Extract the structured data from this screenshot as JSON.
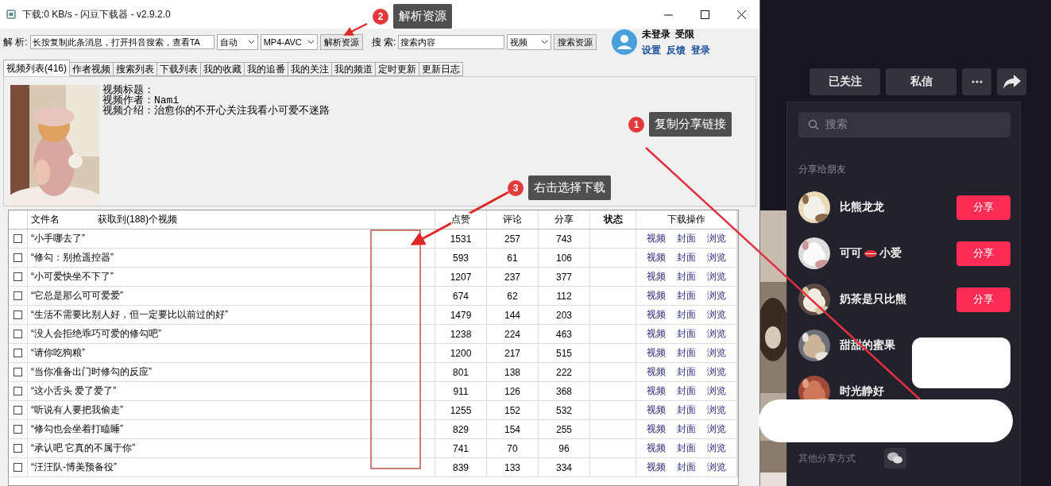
{
  "window": {
    "title": "下载:0 KB/s - 闪豆下载器 - v2.9.2.0"
  },
  "toolbar": {
    "parse_label": "解 析:",
    "parse_value": "长按复制此条消息，打开抖音搜索，查看TA",
    "quality": "自动",
    "codec": "MP4-AVC",
    "parse_button": "解析资源",
    "search_label": "搜 索:",
    "search_value": "搜索内容",
    "search_type": "视频",
    "search_button": "搜索资源"
  },
  "account": {
    "status": "未登录",
    "limit": "受限",
    "links": [
      "设置",
      "反馈",
      "登录"
    ]
  },
  "tabs": [
    {
      "label": "视频列表(416)",
      "selected": true
    },
    {
      "label": "作者视频",
      "selected": false
    },
    {
      "label": "搜索列表",
      "selected": false
    },
    {
      "label": "下载列表",
      "selected": false
    },
    {
      "label": "我的收藏",
      "selected": false
    },
    {
      "label": "我的追番",
      "selected": false
    },
    {
      "label": "我的关注",
      "selected": false
    },
    {
      "label": "我的频道",
      "selected": false
    },
    {
      "label": "定时更新",
      "selected": false
    },
    {
      "label": "更新日志",
      "selected": false
    }
  ],
  "video_info": {
    "kind": "picture",
    "lines": [
      "视频标题：",
      "视频作者：Nami",
      "视频介绍：治愈你的不开心关注我看小可爱不迷路"
    ]
  },
  "table": {
    "columns": [
      "文件名",
      "获取到(188)个视频",
      "点赞",
      "评论",
      "分享",
      "状态",
      "下载操作"
    ],
    "rows": [
      {
        "checked": false,
        "name": "“小手哪去了”",
        "likes": "1531",
        "comments": "257",
        "shares": "743",
        "actions": [
          "视频",
          "封面",
          "浏览"
        ]
      },
      {
        "checked": false,
        "name": "“修勾：别抢遥控器”",
        "likes": "593",
        "comments": "61",
        "shares": "106",
        "actions": [
          "视频",
          "封面",
          "浏览"
        ]
      },
      {
        "checked": false,
        "name": "“小可爱快坐不下了”",
        "likes": "1207",
        "comments": "237",
        "shares": "377",
        "actions": [
          "视频",
          "封面",
          "浏览"
        ]
      },
      {
        "checked": false,
        "name": "“它总是那么可可爱爱”",
        "likes": "674",
        "comments": "62",
        "shares": "112",
        "actions": [
          "视频",
          "封面",
          "浏览"
        ]
      },
      {
        "checked": false,
        "name": "“生活不需要比别人好，但一定要比以前过的好”",
        "likes": "1479",
        "comments": "144",
        "shares": "203",
        "actions": [
          "视频",
          "封面",
          "浏览"
        ]
      },
      {
        "checked": false,
        "name": "“没人会拒绝乖巧可爱的修勾吧”",
        "likes": "1238",
        "comments": "224",
        "shares": "463",
        "actions": [
          "视频",
          "封面",
          "浏览"
        ]
      },
      {
        "checked": false,
        "name": "“请你吃狗粮”",
        "likes": "1200",
        "comments": "217",
        "shares": "515",
        "actions": [
          "视频",
          "封面",
          "浏览"
        ]
      },
      {
        "checked": false,
        "name": "“当你准备出门时修勾的反应”",
        "likes": "801",
        "comments": "138",
        "shares": "222",
        "actions": [
          "视频",
          "封面",
          "浏览"
        ]
      },
      {
        "checked": false,
        "name": "“这小舌头  爱了爱了”",
        "likes": "911",
        "comments": "126",
        "shares": "368",
        "actions": [
          "视频",
          "封面",
          "浏览"
        ]
      },
      {
        "checked": false,
        "name": "“听说有人要把我偷走”",
        "likes": "1255",
        "comments": "152",
        "shares": "532",
        "actions": [
          "视频",
          "封面",
          "浏览"
        ]
      },
      {
        "checked": false,
        "name": "“修勾也会坐着打瞌睡”",
        "likes": "829",
        "comments": "154",
        "shares": "255",
        "actions": [
          "视频",
          "封面",
          "浏览"
        ]
      },
      {
        "checked": false,
        "name": "“承认吧 它真的不属于你”",
        "likes": "741",
        "comments": "70",
        "shares": "96",
        "actions": [
          "视频",
          "封面",
          "浏览"
        ]
      },
      {
        "checked": false,
        "name": "“汪汪队-博美预备役”",
        "likes": "839",
        "comments": "133",
        "shares": "334",
        "actions": [
          "视频",
          "封面",
          "浏览"
        ]
      }
    ]
  },
  "annotations": [
    {
      "number": "2",
      "label": "解析资源"
    },
    {
      "number": "1",
      "label": "复制分享链接"
    },
    {
      "number": "3",
      "label": "右击选择下载"
    }
  ],
  "profile_actions": {
    "buttons": [
      "已关注",
      "私信"
    ]
  },
  "share_panel": {
    "search_placeholder": "搜索",
    "section_title": "分享给朋友",
    "friends": [
      {
        "name": "比熊龙龙",
        "button": "分享"
      },
      {
        "name": "可可",
        "suffix": "小爱",
        "button": "分享"
      },
      {
        "name": "奶茶是只比熊",
        "button": "分享"
      },
      {
        "name": "甜甜的蜜果"
      },
      {
        "name": "时光静好"
      }
    ],
    "other_label": "其他分享方式"
  }
}
